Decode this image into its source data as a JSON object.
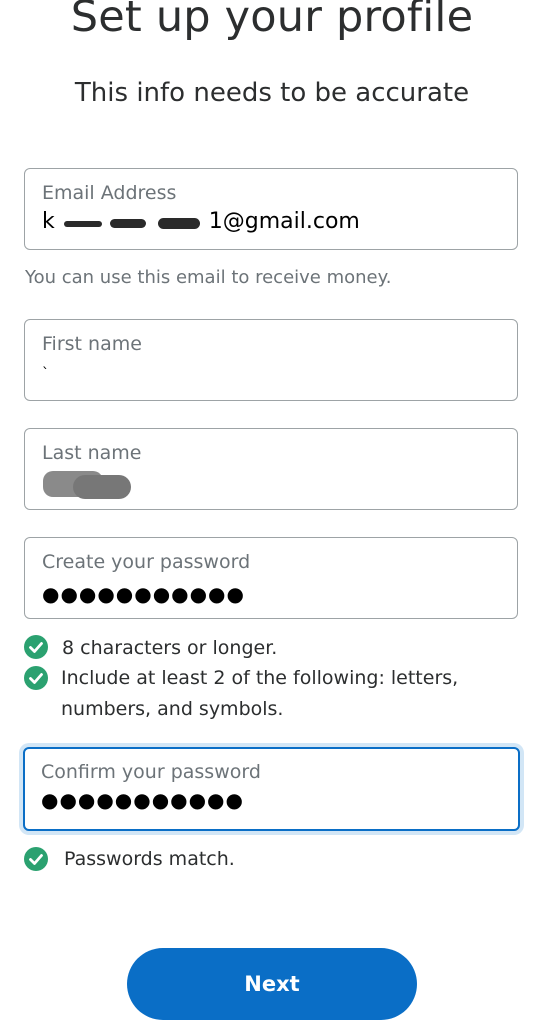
{
  "header": {
    "title": "Set up your profile",
    "subtitle": "This info needs to be accurate"
  },
  "form": {
    "email": {
      "label": "Email Address",
      "value_suffix": "1@gmail.com",
      "value_prefix": "k"
    },
    "email_helper": "You can use this email to receive money.",
    "first_name": {
      "label": "First name",
      "value": "`"
    },
    "last_name": {
      "label": "Last name",
      "value": ""
    },
    "password": {
      "label": "Create your password",
      "value": "●●●●●●●●●●●"
    },
    "password_rules": [
      {
        "text": "8 characters or longer.",
        "met": true
      },
      {
        "text": "Include at least 2 of the following: letters,",
        "met": true
      },
      {
        "text": "numbers, and symbols.",
        "met": true
      }
    ],
    "confirm_password": {
      "label": "Confirm your password",
      "value": "●●●●●●●●●●●"
    },
    "match_status": "Passwords match."
  },
  "actions": {
    "next_label": "Next"
  },
  "colors": {
    "primary": "#0a6ec6",
    "success": "#2ba170",
    "text": "#2c2e2f",
    "muted": "#6c7378",
    "border": "#9da3a6"
  }
}
